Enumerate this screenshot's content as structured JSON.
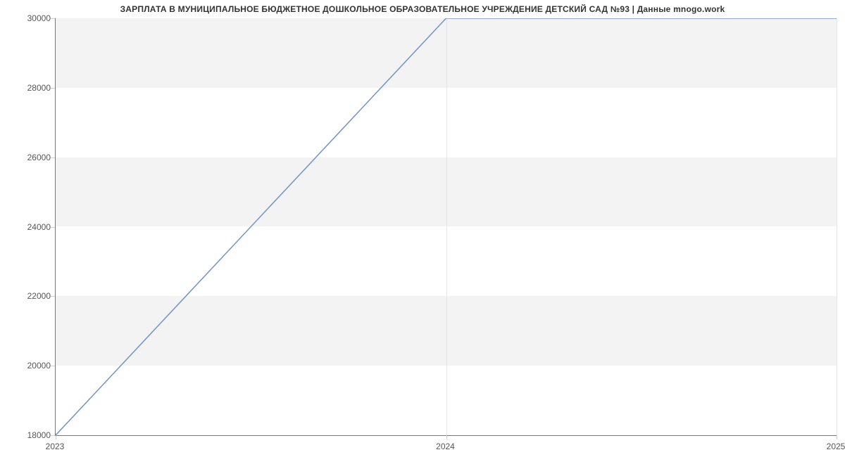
{
  "chart_data": {
    "type": "line",
    "title": "ЗАРПЛАТА В МУНИЦИПАЛЬНОЕ БЮДЖЕТНОЕ ДОШКОЛЬНОЕ ОБРАЗОВАТЕЛЬНОЕ УЧРЕЖДЕНИЕ ДЕТСКИЙ САД №93 | Данные mnogo.work",
    "x": [
      2023,
      2024,
      2025
    ],
    "values": [
      18000,
      30000,
      30000
    ],
    "xlabel": "",
    "ylabel": "",
    "xlim": [
      2023,
      2025
    ],
    "ylim": [
      18000,
      30000
    ],
    "y_ticks": [
      18000,
      20000,
      22000,
      24000,
      26000,
      28000,
      30000
    ],
    "x_ticks": [
      2023,
      2024,
      2025
    ],
    "line_color": "#6f94c9",
    "band_color": "#f3f3f3"
  }
}
